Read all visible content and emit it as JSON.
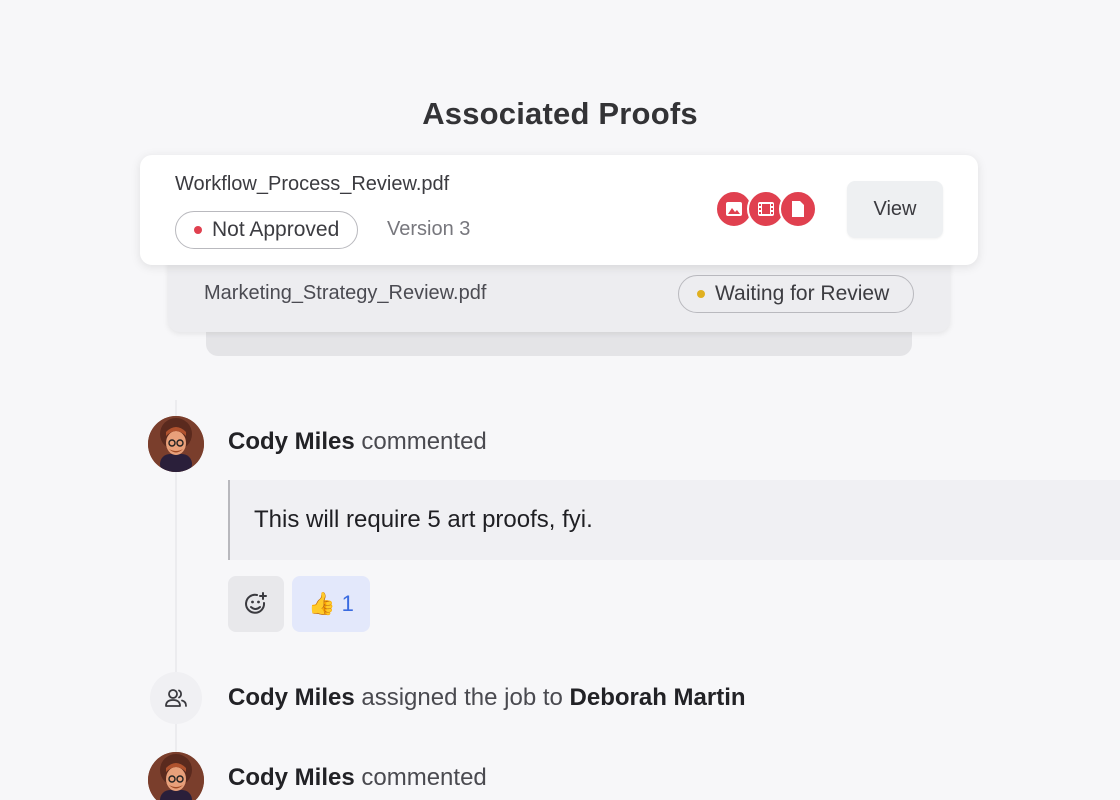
{
  "header": {
    "title": "Associated Proofs"
  },
  "proofs": [
    {
      "filename": "Workflow_Process_Review.pdf",
      "status": "Not Approved",
      "status_color": "#e0404f",
      "version": "Version 3",
      "file_types": [
        "image-icon",
        "video-icon",
        "document-icon"
      ],
      "view_label": "View"
    },
    {
      "filename": "Marketing_Strategy_Review.pdf",
      "status": "Waiting for Review",
      "status_color": "#e0b020"
    }
  ],
  "activity": {
    "comment1": {
      "author": "Cody Miles",
      "action": "commented",
      "text": "This will require 5 art proofs, fyi.",
      "reaction_emoji": "👍",
      "reaction_count": "1"
    },
    "assignment": {
      "author": "Cody Miles",
      "action": "assigned the job to",
      "assignee": "Deborah Martin"
    },
    "comment2": {
      "author": "Cody Miles",
      "action": "commented"
    }
  },
  "colors": {
    "accent_red": "#e0404f",
    "reaction_blue": "#3a6be0",
    "background": "#f7f7f9"
  }
}
